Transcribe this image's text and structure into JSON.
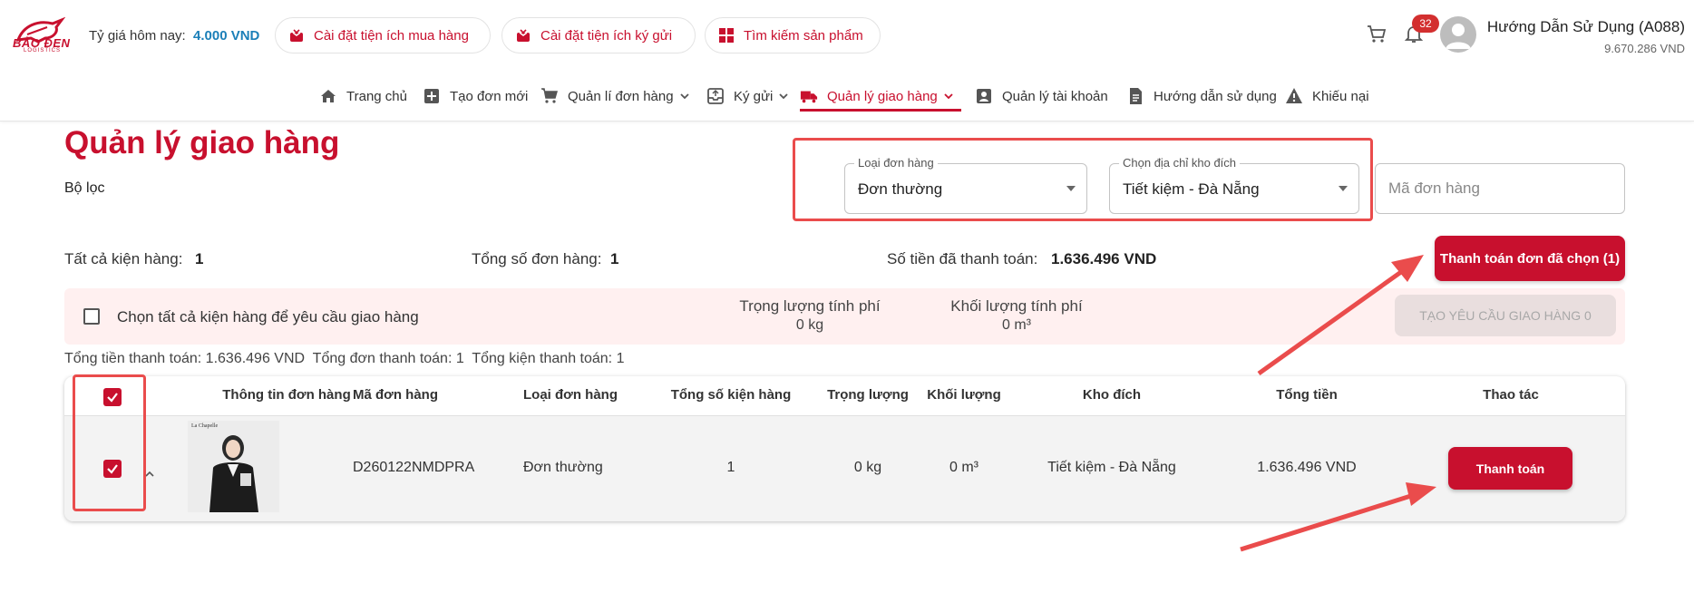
{
  "header": {
    "logo_text": "BẢO ĐEN",
    "logo_sub": "LOGISTICS",
    "rate_label": "Tỷ giá hôm nay:",
    "rate_value": "4.000 VND",
    "pills": [
      {
        "label": "Cài đặt tiện ích mua hàng",
        "icon": "gift-icon"
      },
      {
        "label": "Cài đặt tiện ích ký gửi",
        "icon": "gift-icon"
      },
      {
        "label": "Tìm kiếm sản phẩm",
        "icon": "grid-icon"
      }
    ],
    "notification_count": "32",
    "user_name": "Hướng Dẫn Sử Dụng (A088)",
    "user_balance": "9.670.286 VND"
  },
  "nav": {
    "items": [
      {
        "label": "Trang chủ",
        "icon": "home-icon"
      },
      {
        "label": "Tạo đơn mới",
        "icon": "plus-square-icon"
      },
      {
        "label": "Quản lí đơn hàng",
        "icon": "cart-icon"
      },
      {
        "label": "Ký gửi",
        "icon": "inbox-icon"
      },
      {
        "label": "Quản lý giao hàng",
        "icon": "truck-icon",
        "active": true
      },
      {
        "label": "Quản lý tài khoản",
        "icon": "account-box-icon"
      },
      {
        "label": "Hướng dẫn sử dụng",
        "icon": "document-icon"
      },
      {
        "label": "Khiếu nại",
        "icon": "warning-icon"
      }
    ]
  },
  "page": {
    "title": "Quản lý giao hàng",
    "filter_label": "Bộ lọc"
  },
  "filters": {
    "order_type_legend": "Loại đơn hàng",
    "order_type_value": "Đơn thường",
    "warehouse_legend": "Chọn địa chỉ kho đích",
    "warehouse_value": "Tiết kiệm - Đà Nẵng",
    "order_code_placeholder": "Mã đơn hàng"
  },
  "stats": {
    "all_packages_label": "Tất cả kiện hàng:",
    "all_packages_value": "1",
    "total_orders_label": "Tổng số đơn hàng:",
    "total_orders_value": "1",
    "paid_amount_label": "Số tiền đã thanh toán:",
    "paid_amount_value": "1.636.496 VND",
    "pay_selected_label": "Thanh toán đơn đã chọn (1)"
  },
  "select_bar": {
    "select_all_label": "Chọn tất cả kiện hàng để yêu cầu giao hàng",
    "charged_weight_label": "Trọng lượng tính phí",
    "charged_weight_value": "0 kg",
    "charged_volume_label": "Khối lượng tính phí",
    "charged_volume_value": "0 m³",
    "create_request_label": "TẠO YÊU CẦU GIAO HÀNG 0"
  },
  "summary": {
    "text": "Tổng tiền thanh toán: 1.636.496 VND  Tổng đơn thanh toán: 1  Tổng kiện thanh toán: 1"
  },
  "table": {
    "columns": [
      "Thông tin đơn hàng",
      "Mã đơn hàng",
      "Loại đơn hàng",
      "Tổng số kiện hàng",
      "Trọng lượng",
      "Khối lượng",
      "Kho đích",
      "Tổng tiền",
      "Thao tác"
    ],
    "rows": [
      {
        "order_code": "D260122NMDPRA",
        "order_type": "Đơn thường",
        "package_count": "1",
        "weight": "0 kg",
        "volume": "0 m³",
        "warehouse": "Tiết kiệm - Đà Nẵng",
        "total": "1.636.496 VND",
        "action_label": "Thanh toán",
        "thumb_brand": "La Chapelle"
      }
    ]
  },
  "colors": {
    "brand_red": "#c8102e",
    "link_blue": "#1b7fb8",
    "annotation_red": "#ea4c4c"
  }
}
